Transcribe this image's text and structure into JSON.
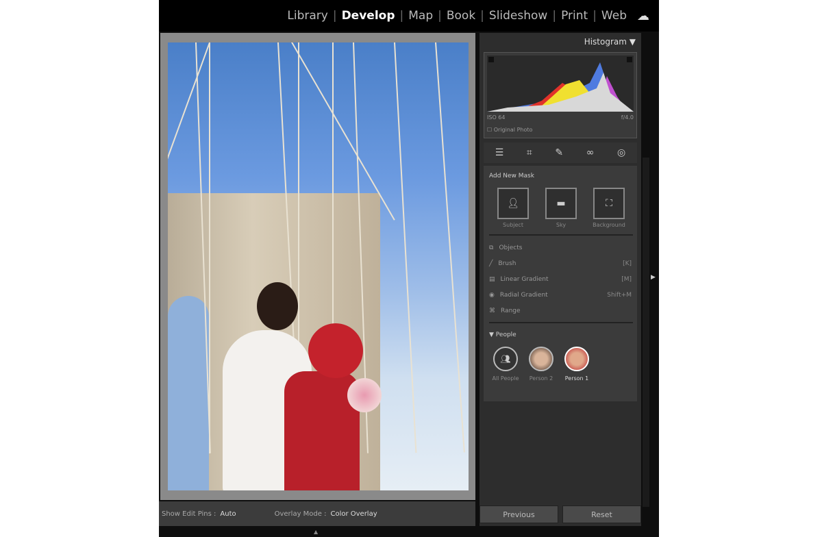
{
  "topbar": {
    "modules": [
      "Library",
      "Develop",
      "Map",
      "Book",
      "Slideshow",
      "Print",
      "Web"
    ],
    "active": "Develop",
    "cloud_icon": "cloud-icon"
  },
  "histogram": {
    "title": "Histogram",
    "info_left": "ISO 64",
    "info_right": "f/4.0",
    "original_photo": "Original Photo"
  },
  "tools": [
    "sliders-icon",
    "crop-icon",
    "healing-icon",
    "red-eye-icon",
    "masking-icon"
  ],
  "masks": {
    "add_new_mask": "Add New Mask",
    "quick": [
      {
        "label": "Subject",
        "icon": "person-icon"
      },
      {
        "label": "Sky",
        "icon": "sky-icon"
      },
      {
        "label": "Background",
        "icon": "background-icon"
      }
    ],
    "tools": [
      {
        "label": "Objects",
        "key": "",
        "icon": "objects-icon"
      },
      {
        "label": "Brush",
        "key": "[K]",
        "icon": "brush-icon"
      },
      {
        "label": "Linear Gradient",
        "key": "[M]",
        "icon": "linear-gradient-icon"
      },
      {
        "label": "Radial Gradient",
        "key": "Shift+M",
        "icon": "radial-gradient-icon"
      },
      {
        "label": "Range",
        "key": "",
        "icon": "range-icon"
      }
    ],
    "people_heading": "People",
    "people": [
      {
        "label": "All People"
      },
      {
        "label": "Person 2"
      },
      {
        "label": "Person 1"
      }
    ]
  },
  "bottom": {
    "edit_pins_label": "Show Edit Pins :",
    "edit_pins_value": "Auto",
    "overlay_label": "Overlay Mode :",
    "overlay_value": "Color Overlay"
  },
  "buttons": {
    "previous": "Previous",
    "reset": "Reset"
  },
  "colors": {
    "overlay": "#c4222c",
    "panel": "#2d2d2d"
  }
}
